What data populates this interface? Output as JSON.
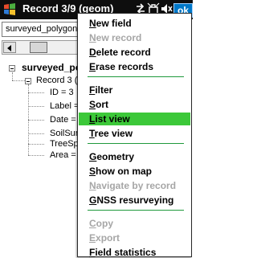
{
  "titlebar": {
    "title": "Record 3/9 (geom)",
    "ok_label": "ok",
    "icons": [
      "windows-logo-icon",
      "connectivity-icon",
      "network-icon",
      "volume-icon"
    ]
  },
  "combo": {
    "value": "surveyed_polygon"
  },
  "tree": {
    "root_label": "surveyed_po",
    "record_label": "Record 3 (",
    "fields": [
      "ID = 3",
      "Label =",
      "Date =",
      "SoilSur",
      "TreeSp",
      "Area ="
    ]
  },
  "menu": {
    "groups": [
      [
        {
          "label": "New field",
          "ul": "N",
          "rest": "ew field",
          "enabled": true
        },
        {
          "label": "New record",
          "ul": "N",
          "rest": "ew record",
          "enabled": false
        },
        {
          "label": "Delete record",
          "ul": "D",
          "rest": "elete record",
          "enabled": true
        },
        {
          "label": "Erase records",
          "ul": "E",
          "rest": "rase records",
          "enabled": true
        }
      ],
      [
        {
          "label": "Filter",
          "ul": "F",
          "rest": "ilter",
          "enabled": true
        },
        {
          "label": "Sort",
          "ul": "S",
          "rest": "ort",
          "enabled": true
        },
        {
          "label": "List view",
          "ul": "L",
          "rest": "ist view",
          "enabled": true,
          "selected": true
        },
        {
          "label": "Tree view",
          "ul": "T",
          "rest": "ree view",
          "enabled": true
        }
      ],
      [
        {
          "label": "Geometry",
          "ul": "G",
          "rest": "eometry",
          "enabled": true
        },
        {
          "label": "Show on map",
          "ul": "S",
          "rest": "how on map",
          "enabled": true
        },
        {
          "label": "Navigate by record",
          "ul": "N",
          "rest": "avigate by record",
          "enabled": false
        },
        {
          "label": "GNSS resurveying",
          "ul": "G",
          "rest": "NSS resurveying",
          "enabled": true
        }
      ],
      [
        {
          "label": "Copy",
          "ul": "C",
          "rest": "opy",
          "enabled": false
        },
        {
          "label": "Export",
          "ul": "E",
          "rest": "xport",
          "enabled": false
        },
        {
          "label": "Field statistics",
          "ul": "F",
          "rest": "ield statistics",
          "enabled": true
        }
      ]
    ]
  },
  "colors": {
    "titlebar": "#0e0e0e",
    "highlight": "#3cc839",
    "separator": "#1f9a3c",
    "disabled_text": "#a6a6a6",
    "ok_button": "#0078c8"
  }
}
